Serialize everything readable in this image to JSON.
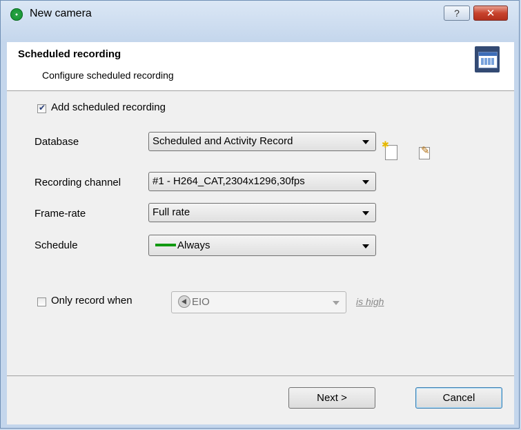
{
  "window": {
    "title": "New camera",
    "help_label": "?",
    "close_label": "✕"
  },
  "header": {
    "title": "Scheduled recording",
    "subtitle": "Configure scheduled recording",
    "icon": "calendar-film-icon"
  },
  "form": {
    "add_scheduled": {
      "label": "Add scheduled recording",
      "checked": true
    },
    "database": {
      "label": "Database",
      "value": "Scheduled and Activity Record"
    },
    "recording_channel": {
      "label": "Recording channel",
      "value": "#1 - H264_CAT,2304x1296,30fps"
    },
    "frame_rate": {
      "label": "Frame-rate",
      "value": "Full rate"
    },
    "schedule": {
      "label": "Schedule",
      "value": "Always",
      "color": "#119911"
    },
    "only_record": {
      "label": "Only record when",
      "checked": false,
      "io_value": "EIO",
      "condition": "is high"
    }
  },
  "footer": {
    "next_label": "Next >",
    "cancel_label": "Cancel"
  }
}
